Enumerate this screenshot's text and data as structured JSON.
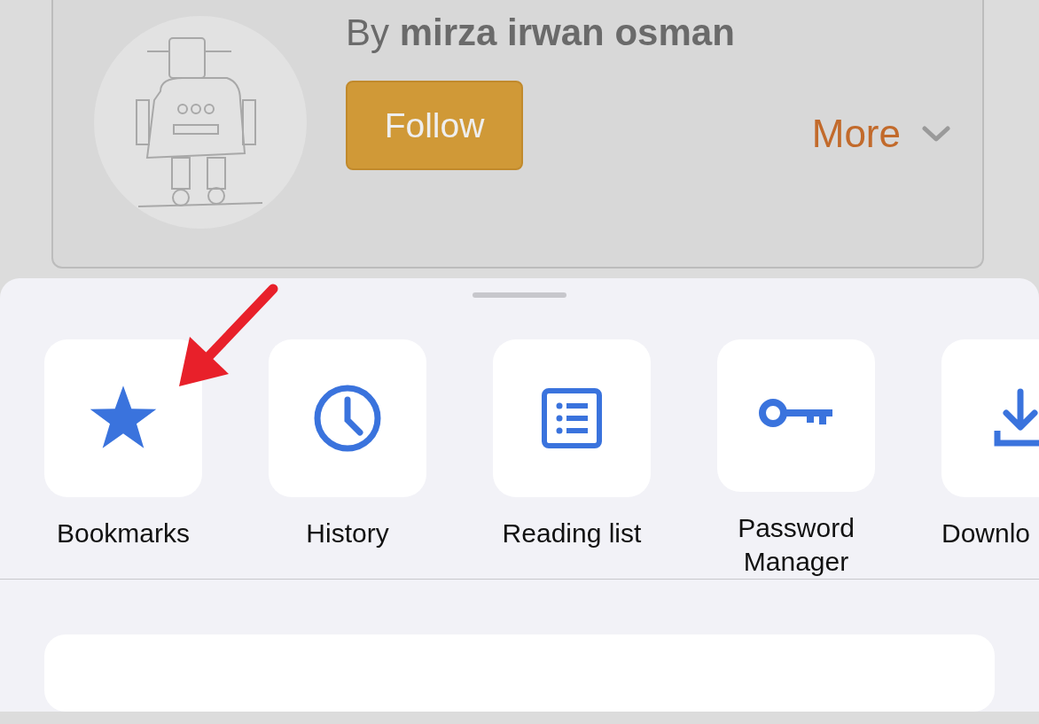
{
  "author_card": {
    "byline": "By **mirza irwan osman**",
    "follow_button": "Follow",
    "more_link": "More"
  },
  "menu_sheet": {
    "items": [
      {
        "label": "Bookmarks"
      },
      {
        "label": "History"
      },
      {
        "label": "Reading list"
      },
      {
        "label": "Password Manager"
      },
      {
        "label": "Downlo"
      }
    ]
  }
}
